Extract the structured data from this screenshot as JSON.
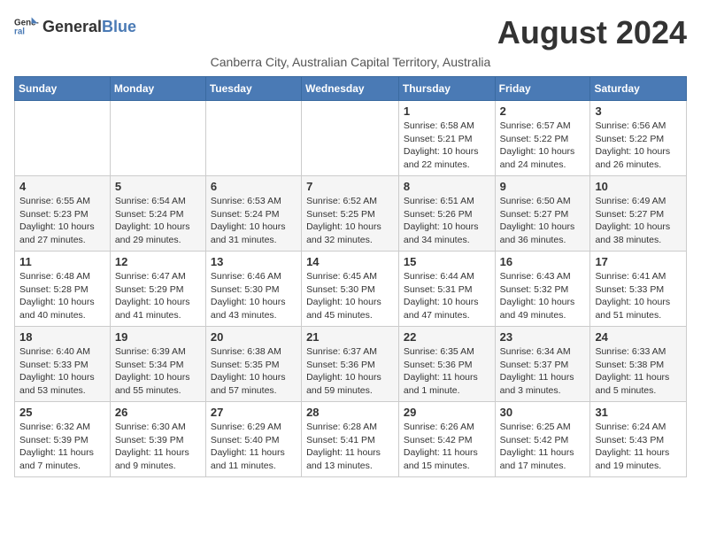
{
  "logo": {
    "general": "General",
    "blue": "Blue"
  },
  "header": {
    "month_year": "August 2024",
    "subtitle": "Canberra City, Australian Capital Territory, Australia"
  },
  "weekdays": [
    "Sunday",
    "Monday",
    "Tuesday",
    "Wednesday",
    "Thursday",
    "Friday",
    "Saturday"
  ],
  "weeks": [
    [
      null,
      null,
      null,
      null,
      {
        "day": "1",
        "sunrise": "6:58 AM",
        "sunset": "5:21 PM",
        "daylight": "10 hours and 22 minutes."
      },
      {
        "day": "2",
        "sunrise": "6:57 AM",
        "sunset": "5:22 PM",
        "daylight": "10 hours and 24 minutes."
      },
      {
        "day": "3",
        "sunrise": "6:56 AM",
        "sunset": "5:22 PM",
        "daylight": "10 hours and 26 minutes."
      }
    ],
    [
      {
        "day": "4",
        "sunrise": "6:55 AM",
        "sunset": "5:23 PM",
        "daylight": "10 hours and 27 minutes."
      },
      {
        "day": "5",
        "sunrise": "6:54 AM",
        "sunset": "5:24 PM",
        "daylight": "10 hours and 29 minutes."
      },
      {
        "day": "6",
        "sunrise": "6:53 AM",
        "sunset": "5:24 PM",
        "daylight": "10 hours and 31 minutes."
      },
      {
        "day": "7",
        "sunrise": "6:52 AM",
        "sunset": "5:25 PM",
        "daylight": "10 hours and 32 minutes."
      },
      {
        "day": "8",
        "sunrise": "6:51 AM",
        "sunset": "5:26 PM",
        "daylight": "10 hours and 34 minutes."
      },
      {
        "day": "9",
        "sunrise": "6:50 AM",
        "sunset": "5:27 PM",
        "daylight": "10 hours and 36 minutes."
      },
      {
        "day": "10",
        "sunrise": "6:49 AM",
        "sunset": "5:27 PM",
        "daylight": "10 hours and 38 minutes."
      }
    ],
    [
      {
        "day": "11",
        "sunrise": "6:48 AM",
        "sunset": "5:28 PM",
        "daylight": "10 hours and 40 minutes."
      },
      {
        "day": "12",
        "sunrise": "6:47 AM",
        "sunset": "5:29 PM",
        "daylight": "10 hours and 41 minutes."
      },
      {
        "day": "13",
        "sunrise": "6:46 AM",
        "sunset": "5:30 PM",
        "daylight": "10 hours and 43 minutes."
      },
      {
        "day": "14",
        "sunrise": "6:45 AM",
        "sunset": "5:30 PM",
        "daylight": "10 hours and 45 minutes."
      },
      {
        "day": "15",
        "sunrise": "6:44 AM",
        "sunset": "5:31 PM",
        "daylight": "10 hours and 47 minutes."
      },
      {
        "day": "16",
        "sunrise": "6:43 AM",
        "sunset": "5:32 PM",
        "daylight": "10 hours and 49 minutes."
      },
      {
        "day": "17",
        "sunrise": "6:41 AM",
        "sunset": "5:33 PM",
        "daylight": "10 hours and 51 minutes."
      }
    ],
    [
      {
        "day": "18",
        "sunrise": "6:40 AM",
        "sunset": "5:33 PM",
        "daylight": "10 hours and 53 minutes."
      },
      {
        "day": "19",
        "sunrise": "6:39 AM",
        "sunset": "5:34 PM",
        "daylight": "10 hours and 55 minutes."
      },
      {
        "day": "20",
        "sunrise": "6:38 AM",
        "sunset": "5:35 PM",
        "daylight": "10 hours and 57 minutes."
      },
      {
        "day": "21",
        "sunrise": "6:37 AM",
        "sunset": "5:36 PM",
        "daylight": "10 hours and 59 minutes."
      },
      {
        "day": "22",
        "sunrise": "6:35 AM",
        "sunset": "5:36 PM",
        "daylight": "11 hours and 1 minute."
      },
      {
        "day": "23",
        "sunrise": "6:34 AM",
        "sunset": "5:37 PM",
        "daylight": "11 hours and 3 minutes."
      },
      {
        "day": "24",
        "sunrise": "6:33 AM",
        "sunset": "5:38 PM",
        "daylight": "11 hours and 5 minutes."
      }
    ],
    [
      {
        "day": "25",
        "sunrise": "6:32 AM",
        "sunset": "5:39 PM",
        "daylight": "11 hours and 7 minutes."
      },
      {
        "day": "26",
        "sunrise": "6:30 AM",
        "sunset": "5:39 PM",
        "daylight": "11 hours and 9 minutes."
      },
      {
        "day": "27",
        "sunrise": "6:29 AM",
        "sunset": "5:40 PM",
        "daylight": "11 hours and 11 minutes."
      },
      {
        "day": "28",
        "sunrise": "6:28 AM",
        "sunset": "5:41 PM",
        "daylight": "11 hours and 13 minutes."
      },
      {
        "day": "29",
        "sunrise": "6:26 AM",
        "sunset": "5:42 PM",
        "daylight": "11 hours and 15 minutes."
      },
      {
        "day": "30",
        "sunrise": "6:25 AM",
        "sunset": "5:42 PM",
        "daylight": "11 hours and 17 minutes."
      },
      {
        "day": "31",
        "sunrise": "6:24 AM",
        "sunset": "5:43 PM",
        "daylight": "11 hours and 19 minutes."
      }
    ]
  ]
}
